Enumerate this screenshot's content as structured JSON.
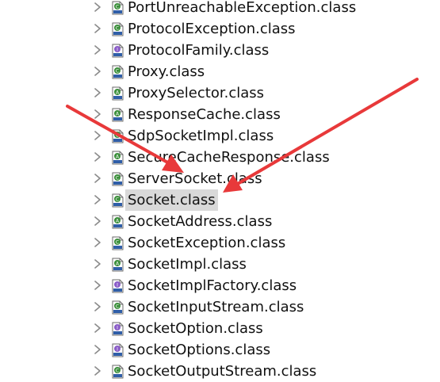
{
  "tree": {
    "items": [
      {
        "label": "PortUnreachableException.class",
        "icon": "class-file-icon"
      },
      {
        "label": "ProtocolException.class",
        "icon": "class-file-icon"
      },
      {
        "label": "ProtocolFamily.class",
        "icon": "interface-file-icon"
      },
      {
        "label": "Proxy.class",
        "icon": "class-file-icon"
      },
      {
        "label": "ProxySelector.class",
        "icon": "abstract-class-file-icon"
      },
      {
        "label": "ResponseCache.class",
        "icon": "abstract-class-file-icon"
      },
      {
        "label": "SdpSocketImpl.class",
        "icon": "class-file-icon"
      },
      {
        "label": "SecureCacheResponse.class",
        "icon": "abstract-class-file-icon"
      },
      {
        "label": "ServerSocket.class",
        "icon": "class-file-icon"
      },
      {
        "label": "Socket.class",
        "icon": "class-file-icon",
        "selected": true
      },
      {
        "label": "SocketAddress.class",
        "icon": "abstract-class-file-icon"
      },
      {
        "label": "SocketException.class",
        "icon": "class-file-icon"
      },
      {
        "label": "SocketImpl.class",
        "icon": "abstract-class-file-icon"
      },
      {
        "label": "SocketImplFactory.class",
        "icon": "interface-file-icon"
      },
      {
        "label": "SocketInputStream.class",
        "icon": "class-file-icon"
      },
      {
        "label": "SocketOption.class",
        "icon": "interface-file-icon"
      },
      {
        "label": "SocketOptions.class",
        "icon": "interface-file-icon"
      },
      {
        "label": "SocketOutputStream.class",
        "icon": "class-file-icon"
      }
    ]
  },
  "annotations": {
    "arrow_color": "#e8393a",
    "arrows": [
      "red-arrow-left",
      "red-arrow-right"
    ]
  }
}
